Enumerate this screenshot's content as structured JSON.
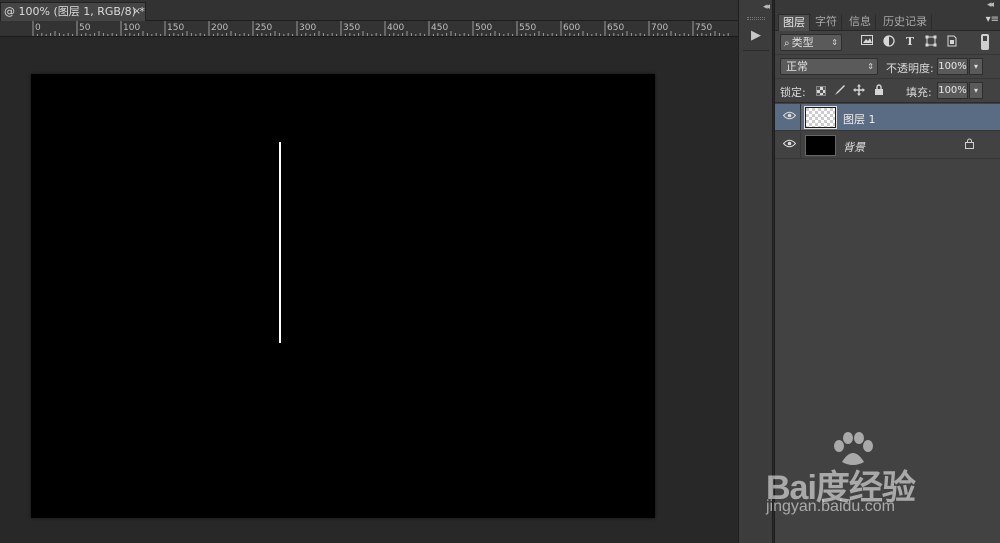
{
  "document": {
    "tab_title": "@ 100% (图层 1, RGB/8) *",
    "tab_close": "×"
  },
  "ruler": {
    "labels": [
      "0",
      "50",
      "100",
      "150",
      "200",
      "250",
      "300",
      "350",
      "400",
      "450",
      "500",
      "550",
      "600",
      "650",
      "700",
      "750"
    ]
  },
  "canvas": {
    "background_color": "#000000",
    "line_color": "#ffffff"
  },
  "toolstrip": {
    "collapse_left": "◂◂",
    "play_icon": "▶"
  },
  "panel": {
    "collapse_right": "◂◂",
    "menu_icon": "▾≡",
    "tabs": [
      {
        "label": "图层",
        "active": true
      },
      {
        "label": "字符",
        "active": false
      },
      {
        "label": "信息",
        "active": false
      },
      {
        "label": "历史记录",
        "active": false
      }
    ],
    "filter": {
      "select_icon": "⌕",
      "select_label": "类型",
      "arrows": "⇕"
    },
    "blend_mode": "正常",
    "opacity_label": "不透明度:",
    "opacity_value": "100%",
    "lock_label": "锁定:",
    "fill_label": "填充:",
    "fill_value": "100%",
    "dropdown_arrow": "▾",
    "layers": [
      {
        "name": "图层 1",
        "selected": true,
        "thumb": "transparent",
        "locked": false
      },
      {
        "name": "背景",
        "selected": false,
        "thumb": "black",
        "locked": true
      }
    ],
    "eye_icon": "◉",
    "lock_icon": "🔒"
  },
  "watermark": {
    "brand": "Bai度经验",
    "url": "jingyan.baidu.com"
  }
}
